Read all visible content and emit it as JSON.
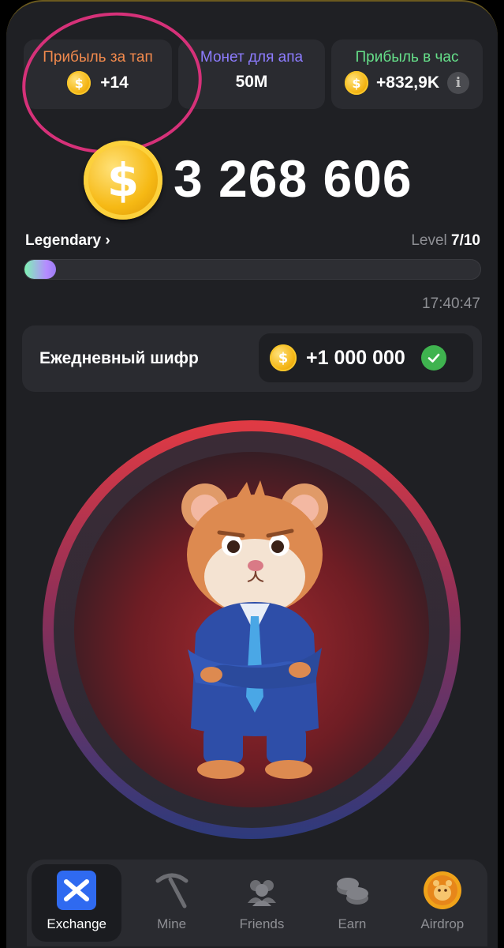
{
  "stats": [
    {
      "label": "Прибыль за тап",
      "value": "+14",
      "label_color": "#f28a4d",
      "has_coin": true
    },
    {
      "label": "Монет для апа",
      "value": "50M",
      "label_color": "#8d7cff",
      "has_coin": false
    },
    {
      "label": "Прибыль в час",
      "value": "+832,9K",
      "label_color": "#66e08a",
      "has_coin": true,
      "info_icon": "info-icon"
    }
  ],
  "coin_symbol": "$",
  "balance": "3 268 606",
  "league": {
    "name": "Legendary",
    "chevron": "›"
  },
  "level": {
    "prefix": "Level",
    "value": "7/10",
    "progress": 0.07
  },
  "clock": "17:40:47",
  "daily_cipher": {
    "title": "Ежедневный шифр",
    "reward": "+1 000 000",
    "status_icon": "check-icon"
  },
  "nav": [
    {
      "label": "Exchange",
      "icon": "exchange-icon",
      "active": true
    },
    {
      "label": "Mine",
      "icon": "pickaxe-icon",
      "active": false
    },
    {
      "label": "Friends",
      "icon": "friends-icon",
      "active": false
    },
    {
      "label": "Earn",
      "icon": "coins-icon",
      "active": false
    },
    {
      "label": "Airdrop",
      "icon": "hamster-coin-icon",
      "active": false
    }
  ],
  "colors": {
    "accent_orange": "#f28a4d",
    "accent_purple": "#8d7cff",
    "accent_green": "#66e08a",
    "annotation": "#d63179",
    "coin": "#f6b914"
  }
}
